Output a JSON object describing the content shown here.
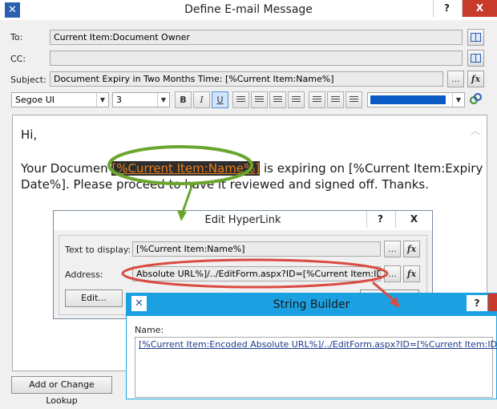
{
  "main_window": {
    "title": "Define E-mail Message",
    "help_glyph": "?",
    "close_glyph": "X",
    "to_label": "To:",
    "to_value": "Current Item:Document Owner",
    "cc_label": "CC:",
    "cc_value": "",
    "subject_label": "Subject:",
    "subject_value": "Document Expiry in Two Months Time: [%Current Item:Name%]",
    "ellipsis": "...",
    "fx": "fx"
  },
  "toolbar": {
    "font_name": "Segoe UI",
    "font_size": "3",
    "bold": "B",
    "italic": "I",
    "underline": "U",
    "color_hex": "#0b5bc6"
  },
  "body": {
    "greeting": "Hi,",
    "line_start": "Your Documen",
    "line_link": "[%Current Item:Name%]",
    "line_end_1": "is expiring on [%Current Item:Expiry",
    "line_2": "Date%]. Please proceed to have it reviewed and signed off. Thanks."
  },
  "footer": {
    "lookup_button": "Add or Change Lookup"
  },
  "hyperlink_dialog": {
    "title": "Edit HyperLink",
    "help_glyph": "?",
    "close_glyph": "X",
    "text_label": "Text to display:",
    "text_value": "[%Current Item:Name%]",
    "address_label": "Address:",
    "address_value": "Absolute URL%]/../EditForm.aspx?ID=[%Current Item:ID%]",
    "edit_button": "Edit...",
    "ellipsis": "...",
    "fx": "fx"
  },
  "string_builder": {
    "title": "String Builder",
    "name_label": "Name:",
    "value": "[%Current Item:Encoded Absolute URL%]/../EditForm.aspx?ID=[%Current Item:ID%]"
  },
  "colors": {
    "highlight_green": "#6aa62e",
    "highlight_red": "#d94b40",
    "accent_blue": "#2b5fb0",
    "link_orange": "#e8801f"
  }
}
